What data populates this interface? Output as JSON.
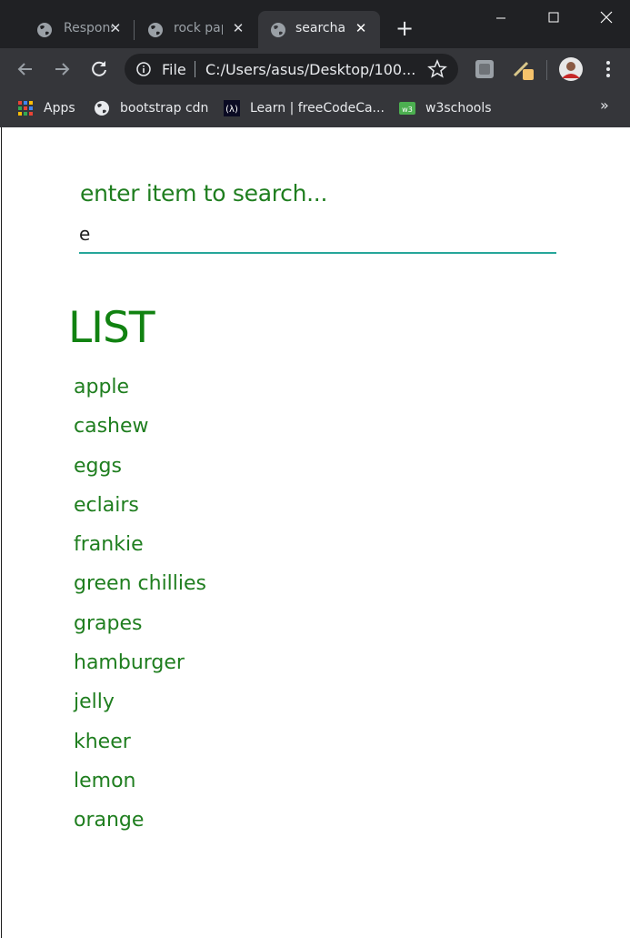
{
  "browser": {
    "tabs": [
      {
        "title": "Respons",
        "active": false,
        "icon": "globe-icon"
      },
      {
        "title": "rock pap",
        "active": false,
        "icon": "globe-icon"
      },
      {
        "title": "searchab",
        "active": true,
        "icon": "globe-icon"
      }
    ],
    "omnibox": {
      "scheme_label": "File",
      "url": "C:/Users/asus/Desktop/100..."
    },
    "bookmarks": [
      {
        "label": "Apps",
        "icon": "apps-grid-icon"
      },
      {
        "label": "bootstrap cdn",
        "icon": "globe-icon"
      },
      {
        "label": "Learn | freeCodeCa...",
        "icon": "freecodecamp-icon"
      },
      {
        "label": "w3schools",
        "icon": "w3schools-icon"
      }
    ],
    "bookmarks_overflow": "»"
  },
  "page": {
    "search": {
      "label": "enter item to search...",
      "value": "e"
    },
    "list_title": "LIST",
    "items": [
      "apple",
      "cashew",
      "eggs",
      "eclairs",
      "frankie",
      "green chillies",
      "grapes",
      "hamburger",
      "jelly",
      "kheer",
      "lemon",
      "orange"
    ]
  },
  "colors": {
    "chrome_dark": "#202124",
    "chrome_toolbar": "#35363a",
    "text_green": "#1f7e1f",
    "title_green": "#118211",
    "input_underline": "#26a69a"
  }
}
